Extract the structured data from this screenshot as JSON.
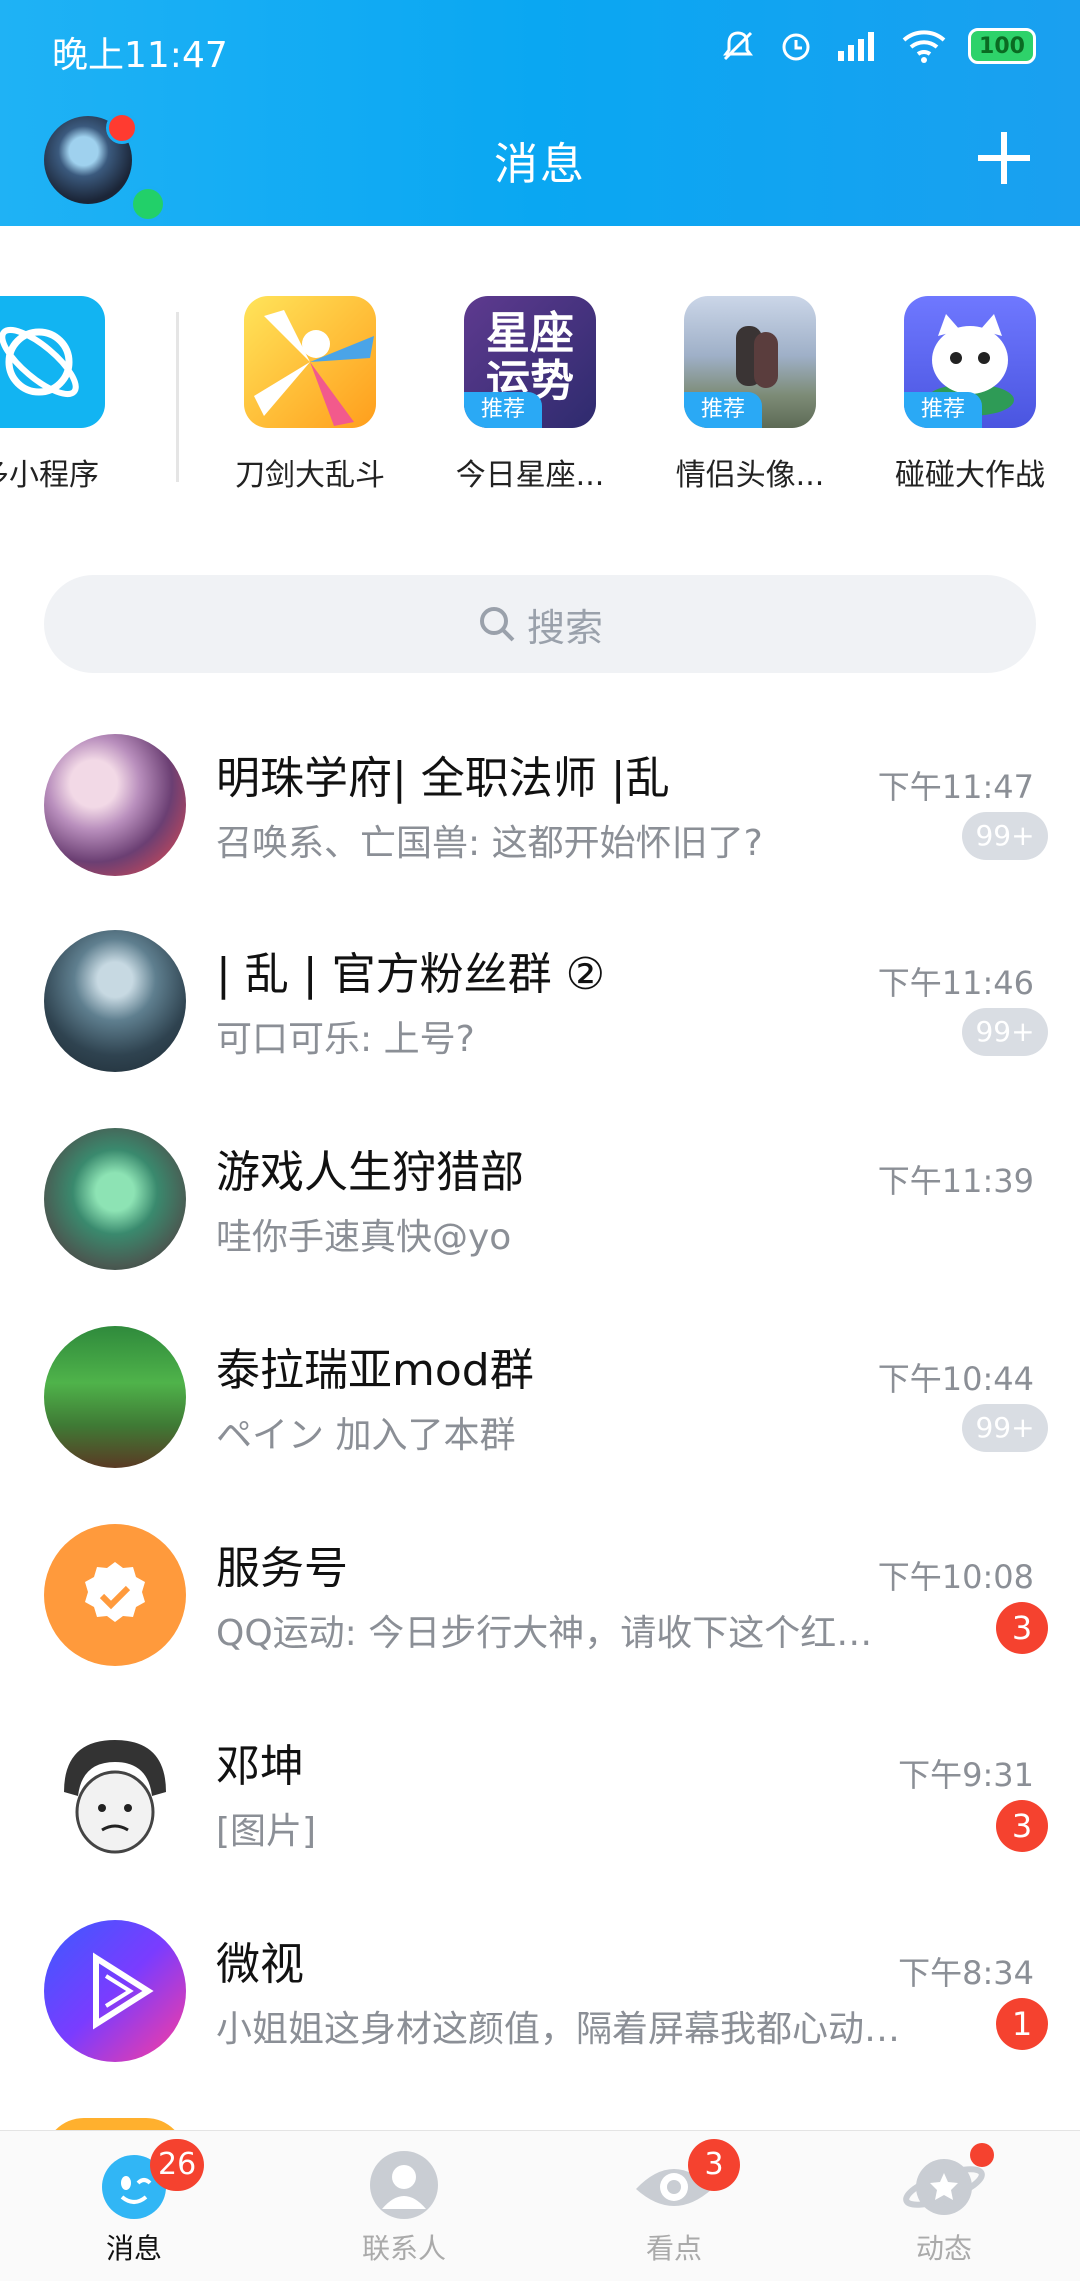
{
  "status_bar": {
    "time": "晚上11:47",
    "battery": "100"
  },
  "header": {
    "title": "消息"
  },
  "mini_apps": [
    {
      "label": "多小程序",
      "tag": ""
    },
    {
      "label": "刀剑大乱斗",
      "tag": ""
    },
    {
      "label": "今日星座...",
      "tag": "推荐",
      "tile_text": "星座运势"
    },
    {
      "label": "情侣头像...",
      "tag": "推荐"
    },
    {
      "label": "碰碰大作战",
      "tag": "推荐"
    }
  ],
  "search": {
    "placeholder": "搜索"
  },
  "chats": [
    {
      "name": "明珠学府| 全职法师 |乱",
      "preview": "召唤系、亡国兽: 这都开始怀旧了?",
      "time": "下午11:47",
      "badge": "99+",
      "badge_type": "gray"
    },
    {
      "name": "| 乱 |  官方粉丝群 ②",
      "preview": "可口可乐: 上号?",
      "time": "下午11:46",
      "badge": "99+",
      "badge_type": "gray"
    },
    {
      "name": "游戏人生狩猎部",
      "preview": "哇你手速真快@yo",
      "time": "下午11:39",
      "badge": "",
      "badge_type": "none"
    },
    {
      "name": "泰拉瑞亚mod群",
      "preview": "ペイン 加入了本群",
      "time": "下午10:44",
      "badge": "99+",
      "badge_type": "gray"
    },
    {
      "name": "服务号",
      "preview": "QQ运动: 今日步行大神，请收下这个红…",
      "time": "下午10:08",
      "badge": "3",
      "badge_type": "red"
    },
    {
      "name": "邓坤",
      "preview": "[图片]",
      "time": "下午9:31",
      "badge": "3",
      "badge_type": "red"
    },
    {
      "name": "微视",
      "preview": "小姐姐这身材这颜值，隔着屏幕我都心动…",
      "time": "下午8:34",
      "badge": "1",
      "badge_type": "red"
    }
  ],
  "tabbar": {
    "items": [
      {
        "label": "消息",
        "badge": "26"
      },
      {
        "label": "联系人",
        "badge": ""
      },
      {
        "label": "看点",
        "badge": "3"
      },
      {
        "label": "动态",
        "badge": ""
      }
    ]
  },
  "colors": {
    "accent": "#0aa7f2",
    "badge_red": "#f5422f",
    "online_green": "#22d069"
  }
}
